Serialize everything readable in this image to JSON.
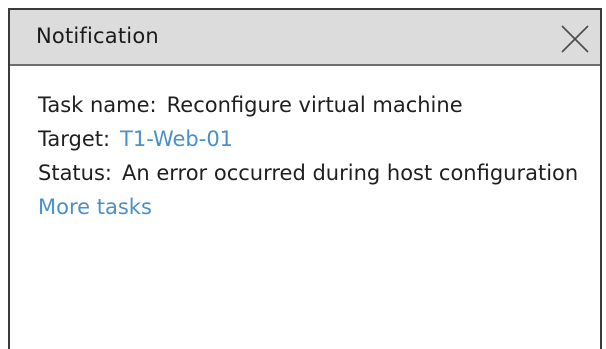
{
  "dialog": {
    "title": "Notification",
    "close_icon": "close-icon"
  },
  "task": {
    "name_label": "Task name:",
    "name_value": "Reconfigure virtual machine",
    "target_label": "Target:",
    "target_value": "T1-Web-01",
    "status_label": "Status:",
    "status_value": "An error occurred during host configuration"
  },
  "links": {
    "more_tasks": "More tasks"
  },
  "colors": {
    "titlebar_bg": "#dcdcdc",
    "link": "#4a90c8",
    "border": "#3a3a3a"
  }
}
